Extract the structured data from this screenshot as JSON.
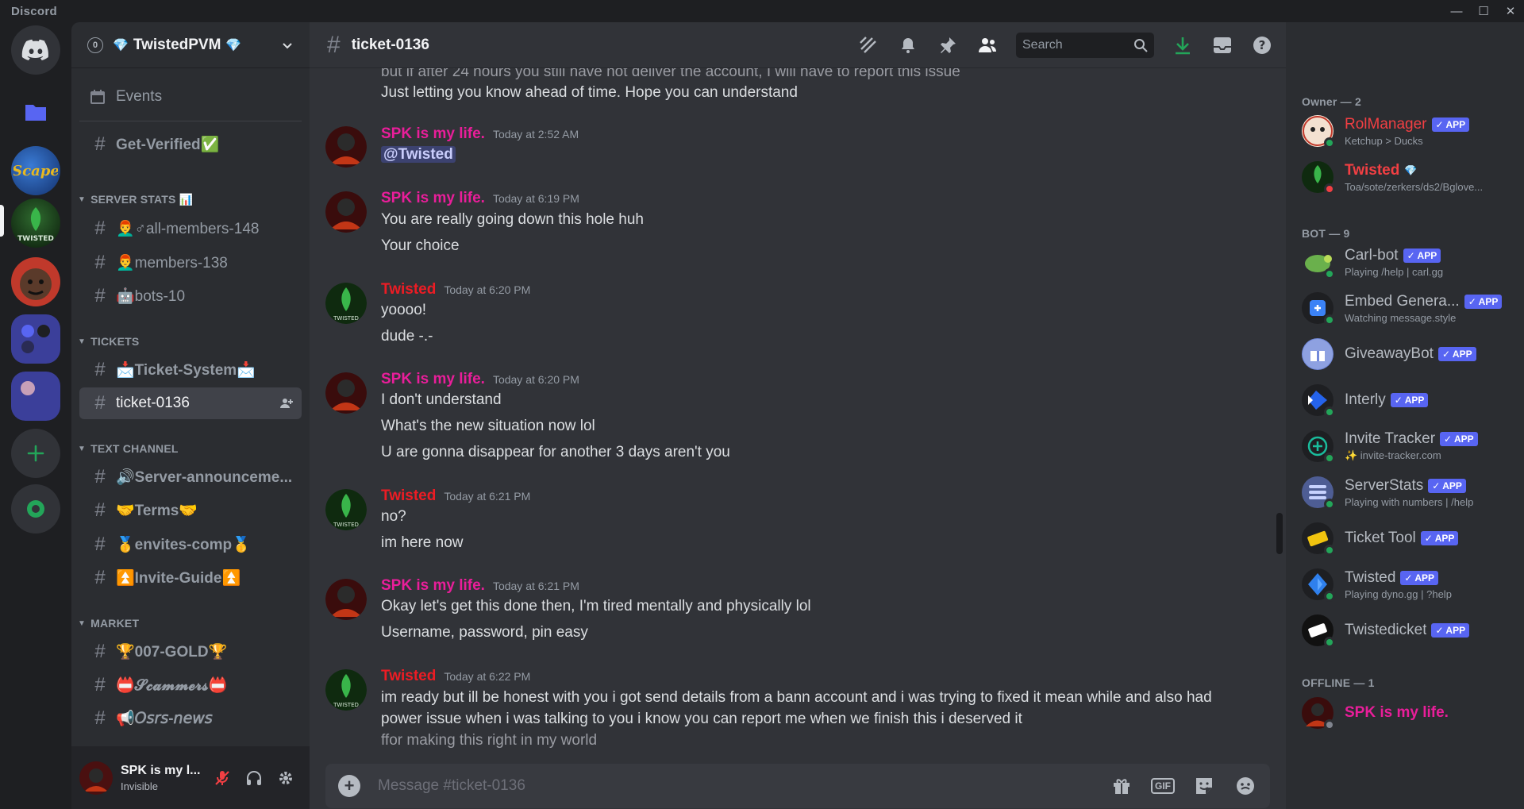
{
  "window": {
    "app_title": "Discord",
    "minimize": "—",
    "maximize": "☐",
    "close": "✕"
  },
  "servers": [
    {
      "name": "direct-messages",
      "color": "#5865f2"
    },
    {
      "name": "folder",
      "color": "#5865f2"
    },
    {
      "name": "scape",
      "color": "#2a5aa8"
    },
    {
      "name": "twisted",
      "color": "#163d16"
    },
    {
      "name": "red-server",
      "color": "#c0392b"
    },
    {
      "name": "folder-group",
      "color": "#3b3f9a"
    },
    {
      "name": "anime-server",
      "color": "#3b3f9a"
    },
    {
      "name": "add-server",
      "color": "#23a559"
    },
    {
      "name": "discover",
      "color": "#23a559"
    }
  ],
  "guild": {
    "badge": "0",
    "name": "TwistedPVM",
    "gem": "💎"
  },
  "sidebar": {
    "events": "Events",
    "get_verified": "Get-Verified✅",
    "cat_stats": "SERVER STATS 📊",
    "all_members": "👨‍🦰♂all-members-148",
    "members": "👨‍🦰members-138",
    "bots": "🤖bots-10",
    "cat_tickets": "TICKETS",
    "ticket_system": "📩Ticket-System📩",
    "ticket_0136": "ticket-0136",
    "cat_text": "TEXT CHANNEL",
    "server_ann": "🔊Server-announceme...",
    "terms": "🤝Terms🤝",
    "envites": "🥇envites-comp🥇",
    "invite_guide": "⏫Invite-Guide⏫",
    "cat_market": "MARKET",
    "gold": "🏆007-GOLD🏆",
    "scammers": "📛𝓢𝓬𝓪𝓶𝓶𝓮𝓻𝓼📛",
    "osrs_news": "📢𝘖𝘴𝘳𝘴-𝘯𝘦𝘸𝘴"
  },
  "user": {
    "name": "SPK is my l...",
    "status": "Invisible"
  },
  "channel": {
    "name": "ticket-0136"
  },
  "header": {
    "search_placeholder": "Search"
  },
  "messages": {
    "cut_top": "but if after 24 hours you still have not deliver the account, I will have to report this issue",
    "l0": "Just letting you know ahead of time. Hope you can understand",
    "g1": {
      "author": "SPK is my life.",
      "time": "Today at 2:52 AM",
      "l1": "@Twisted"
    },
    "g2": {
      "author": "SPK is my life.",
      "time": "Today at 6:19 PM",
      "l1": "You are really going down this hole huh",
      "l2": "Your choice"
    },
    "g3": {
      "author": "Twisted",
      "time": "Today at 6:20 PM",
      "l1": "yoooo!",
      "l2": "dude -.-"
    },
    "g4": {
      "author": "SPK is my life.",
      "time": "Today at 6:20 PM",
      "l1": "I don't understand",
      "l2": "What's the new situation now lol",
      "l3": "U are gonna disappear for another 3 days aren't you"
    },
    "g5": {
      "author": "Twisted",
      "time": "Today at 6:21 PM",
      "l1": "no?",
      "l2": "im here now"
    },
    "g6": {
      "author": "SPK is my life.",
      "time": "Today at 6:21 PM",
      "l1": "Okay let's get this done then, I'm tired mentally and physically lol",
      "l2": "Username, password, pin easy"
    },
    "g7": {
      "author": "Twisted",
      "time": "Today at 6:22 PM",
      "l1": "im ready but ill be honest with you i got send details from a bann account and i was trying to fixed it mean while and also had",
      "l2": "power issue when i was talking to you i know you can report me when we finish this i deserved it",
      "l3": "ffor making this right in my world"
    }
  },
  "composer": {
    "placeholder": "Message #ticket-0136",
    "gif": "GIF"
  },
  "member_list": {
    "owner_cat": "Owner — 2",
    "owners": [
      {
        "name": "RolManager",
        "tag": "✓ APP",
        "activity": "Ketchup > Ducks"
      },
      {
        "name": "Twisted",
        "icon": "💎",
        "activity": "Toa/sote/zerkers/ds2/Bglove..."
      }
    ],
    "bot_cat": "BOT — 9",
    "bots": [
      {
        "name": "Carl-bot",
        "tag": "✓ APP",
        "activity": "Playing /help | carl.gg"
      },
      {
        "name": "Embed Genera...",
        "tag": "✓ APP",
        "activity": "Watching message.style"
      },
      {
        "name": "GiveawayBot",
        "tag": "✓ APP",
        "activity": ""
      },
      {
        "name": "Interly",
        "tag": "✓ APP",
        "activity": ""
      },
      {
        "name": "Invite Tracker",
        "tag": "✓ APP",
        "activity": "✨ invite-tracker.com"
      },
      {
        "name": "ServerStats",
        "tag": "✓ APP",
        "activity": "Playing with numbers | /help"
      },
      {
        "name": "Ticket Tool",
        "tag": "✓ APP",
        "activity": ""
      },
      {
        "name": "Twisted",
        "tag": "✓ APP",
        "activity": "Playing dyno.gg | ?help"
      },
      {
        "name": "Twistedicket",
        "tag": "✓ APP",
        "activity": ""
      }
    ],
    "offline_cat": "OFFLINE — 1",
    "offline": [
      {
        "name": "SPK is my life."
      }
    ]
  },
  "colors": {
    "accent": "#5865f2",
    "online": "#23a559",
    "dnd": "#f23f43",
    "spk": "#e91e9a",
    "twisted": "#ed1c24"
  }
}
